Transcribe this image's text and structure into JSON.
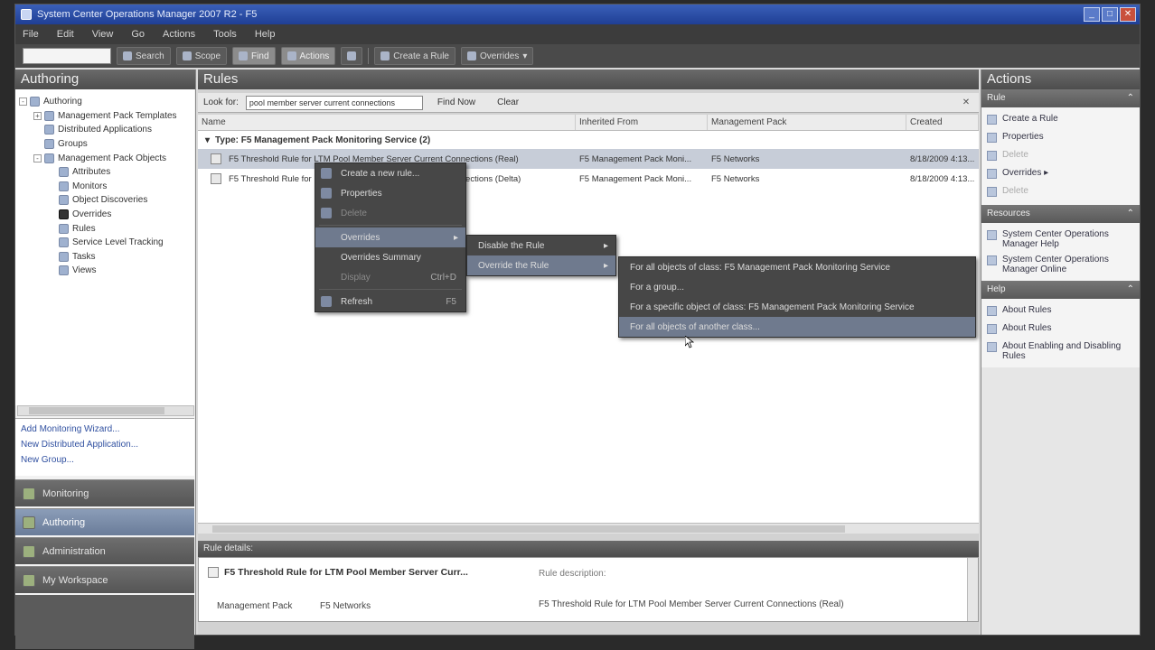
{
  "window": {
    "title": "System Center Operations Manager 2007 R2 - F5",
    "controls": [
      "_",
      "□",
      "✕"
    ]
  },
  "menu": [
    "File",
    "Edit",
    "View",
    "Go",
    "Actions",
    "Tools",
    "Help"
  ],
  "toolbar": {
    "search_value": "",
    "search_label": "Search",
    "scope_label": "Scope",
    "find_label": "Find",
    "actions_label": "Actions",
    "help_icon": "help-icon",
    "create_rule_label": "Create a Rule",
    "overrides_label": "Overrides"
  },
  "left": {
    "header": "Authoring",
    "tree": [
      {
        "label": "Authoring",
        "indent": 0,
        "exp": "-"
      },
      {
        "label": "Management Pack Templates",
        "indent": 1,
        "exp": "+"
      },
      {
        "label": "Distributed Applications",
        "indent": 1,
        "exp": ""
      },
      {
        "label": "Groups",
        "indent": 1,
        "exp": ""
      },
      {
        "label": "Management Pack Objects",
        "indent": 1,
        "exp": "-"
      },
      {
        "label": "Attributes",
        "indent": 2,
        "exp": ""
      },
      {
        "label": "Monitors",
        "indent": 2,
        "exp": ""
      },
      {
        "label": "Object Discoveries",
        "indent": 2,
        "exp": ""
      },
      {
        "label": "Overrides",
        "indent": 2,
        "exp": ""
      },
      {
        "label": "Rules",
        "indent": 2,
        "exp": ""
      },
      {
        "label": "Service Level Tracking",
        "indent": 2,
        "exp": ""
      },
      {
        "label": "Tasks",
        "indent": 2,
        "exp": ""
      },
      {
        "label": "Views",
        "indent": 2,
        "exp": ""
      }
    ],
    "links": [
      "Add Monitoring Wizard...",
      "New Distributed Application...",
      "New Group..."
    ],
    "wunderbar": [
      "Monitoring",
      "Authoring",
      "Administration",
      "My Workspace"
    ]
  },
  "center": {
    "header": "Rules",
    "find": {
      "look_for_label": "Look for:",
      "search_value": "pool member server current connections",
      "find_now": "Find Now",
      "clear": "Clear"
    },
    "columns": [
      "Name",
      "Inherited From",
      "Management Pack",
      "Created"
    ],
    "group_label": "Type: F5 Management Pack Monitoring Service (2)",
    "rows": [
      {
        "name": "F5 Threshold Rule for LTM Pool Member Server Current Connections (Real)",
        "inherited": "F5 Management Pack Moni...",
        "mp": "F5 Networks",
        "created": "8/18/2009 4:13...",
        "selected": true
      },
      {
        "name": "F5 Threshold Rule for LTM Pool Member Server Current Connections (Delta)",
        "inherited": "F5 Management Pack Moni...",
        "mp": "F5 Networks",
        "created": "8/18/2009 4:13...",
        "selected": false
      }
    ],
    "details": {
      "header": "Rule details:",
      "title": "F5 Threshold Rule for LTM Pool Member Server Curr...",
      "desc_label": "Rule description:",
      "mp_label": "Management Pack",
      "mp_value": "F5 Networks",
      "desc_value": "F5 Threshold Rule for LTM Pool Member Server Current Connections (Real)"
    }
  },
  "context_menu": {
    "items": [
      {
        "label": "Create a new rule...",
        "icon": true
      },
      {
        "label": "Properties",
        "icon": true
      },
      {
        "label": "Delete",
        "icon": true,
        "dim": true
      },
      {
        "label": "Overrides",
        "icon": false,
        "arrow": "▸",
        "hl": true
      },
      {
        "label": "Overrides Summary",
        "icon": false
      },
      {
        "label": "Display",
        "icon": false,
        "dim": true,
        "shortcut": "Ctrl+D"
      },
      {
        "label": "Refresh",
        "icon": true,
        "shortcut": "F5"
      }
    ],
    "submenu1": [
      {
        "label": "Disable the Rule",
        "arrow": "▸"
      },
      {
        "label": "Override the Rule",
        "arrow": "▸",
        "hl": true
      }
    ],
    "submenu2": [
      {
        "label": "For all objects of class: F5 Management Pack Monitoring Service"
      },
      {
        "label": "For a group..."
      },
      {
        "label": "For a specific object of class: F5 Management Pack Monitoring Service"
      },
      {
        "label": "For all objects of another class...",
        "hl": true
      }
    ]
  },
  "right": {
    "header": "Actions",
    "sections": [
      {
        "title": "Rule",
        "items": [
          {
            "label": "Create a Rule"
          },
          {
            "label": "Properties"
          },
          {
            "label": "Delete",
            "disabled": true
          },
          {
            "label": "Overrides ▸"
          },
          {
            "label": "Delete",
            "disabled": true
          }
        ]
      },
      {
        "title": "Resources",
        "items": [
          {
            "label": "System Center Operations Manager Help"
          },
          {
            "label": "System Center Operations Manager Online"
          }
        ]
      },
      {
        "title": "Help",
        "items": [
          {
            "label": "About Rules"
          },
          {
            "label": "About Rules"
          },
          {
            "label": "About Enabling and Disabling Rules"
          }
        ]
      }
    ]
  }
}
